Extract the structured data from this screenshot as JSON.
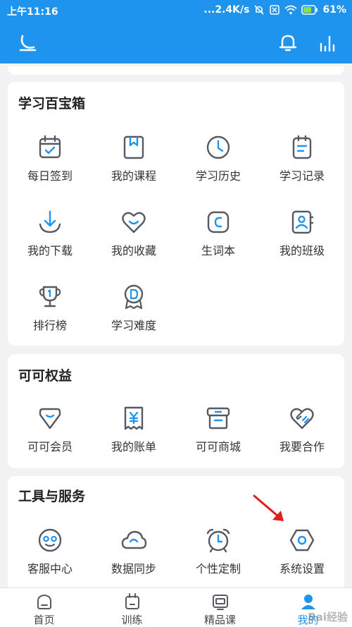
{
  "status_bar": {
    "time": "上午11:16",
    "network_speed": "...2.4K/s",
    "battery": "61%"
  },
  "app_bar": {
    "left_icon": "moon-mode-icon",
    "right_icons": [
      "bell-icon",
      "stats-icon"
    ]
  },
  "sections": [
    {
      "title": "学习百宝箱",
      "items": [
        {
          "label": "每日签到",
          "icon": "calendar-check-icon"
        },
        {
          "label": "我的课程",
          "icon": "bookmark-book-icon"
        },
        {
          "label": "学习历史",
          "icon": "clock-icon"
        },
        {
          "label": "学习记录",
          "icon": "notepad-icon"
        },
        {
          "label": "我的下载",
          "icon": "download-icon"
        },
        {
          "label": "我的收藏",
          "icon": "heart-icon"
        },
        {
          "label": "生词本",
          "icon": "wordbook-icon"
        },
        {
          "label": "我的班级",
          "icon": "class-contact-icon"
        },
        {
          "label": "排行榜",
          "icon": "trophy-icon"
        },
        {
          "label": "学习难度",
          "icon": "medal-d-icon"
        }
      ]
    },
    {
      "title": "可可权益",
      "items": [
        {
          "label": "可可会员",
          "icon": "diamond-icon"
        },
        {
          "label": "我的账单",
          "icon": "bill-yen-icon"
        },
        {
          "label": "可可商城",
          "icon": "shop-box-icon"
        },
        {
          "label": "我要合作",
          "icon": "handshake-heart-icon"
        }
      ]
    },
    {
      "title": "工具与服务",
      "items": [
        {
          "label": "客服中心",
          "icon": "service-face-icon"
        },
        {
          "label": "数据同步",
          "icon": "cloud-sync-icon"
        },
        {
          "label": "个性定制",
          "icon": "alarm-clock-icon"
        },
        {
          "label": "系统设置",
          "icon": "hexagon-settings-icon"
        }
      ]
    }
  ],
  "tab_bar": {
    "tabs": [
      {
        "label": "首页",
        "icon": "home-tab-icon"
      },
      {
        "label": "训练",
        "icon": "train-tab-icon"
      },
      {
        "label": "精品课",
        "icon": "tv-tab-icon"
      },
      {
        "label": "我的",
        "icon": "me-tab-icon"
      }
    ],
    "active": "我的"
  },
  "colors": {
    "primary": "#1e94ef",
    "icon_stroke": "#555a63",
    "icon_accent": "#1e94ef",
    "annotation_arrow": "#e02020"
  },
  "watermark": "Bai经验"
}
